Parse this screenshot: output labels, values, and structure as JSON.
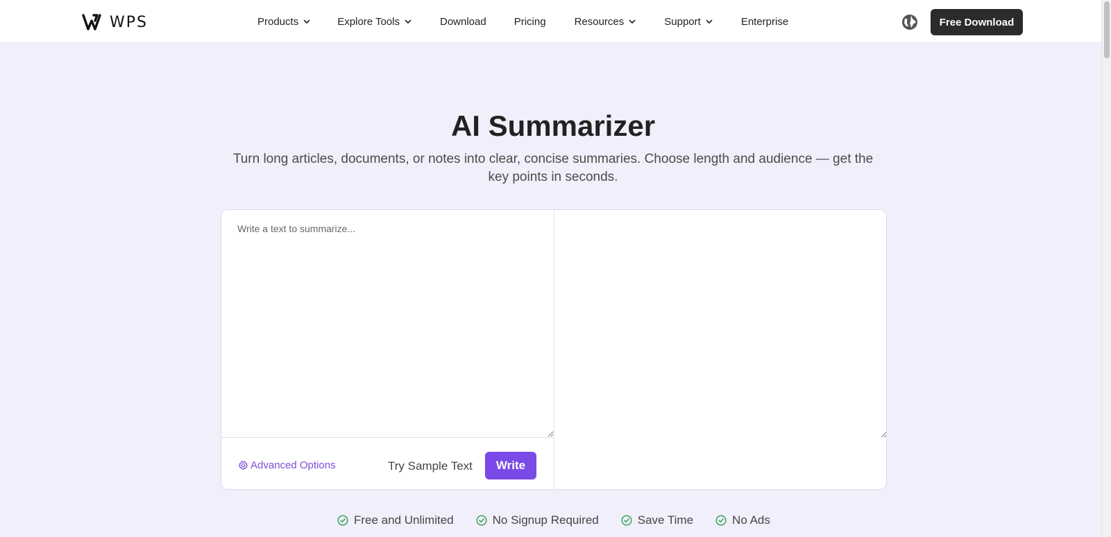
{
  "header": {
    "logo_text": "WPS",
    "nav": [
      {
        "label": "Products",
        "has_dropdown": true
      },
      {
        "label": "Explore Tools",
        "has_dropdown": true
      },
      {
        "label": "Download",
        "has_dropdown": false
      },
      {
        "label": "Pricing",
        "has_dropdown": false
      },
      {
        "label": "Resources",
        "has_dropdown": true
      },
      {
        "label": "Support",
        "has_dropdown": true
      },
      {
        "label": "Enterprise",
        "has_dropdown": false
      }
    ],
    "globe_icon": "globe-icon",
    "cta_label": "Free Download"
  },
  "hero": {
    "title": "AI Summarizer",
    "subtitle": "Turn long articles, documents, or notes into clear, concise summaries. Choose length and audience — get the key points in seconds."
  },
  "editor": {
    "input_placeholder": "Write a text to summarize...",
    "input_value": "",
    "output_value": "",
    "advanced_label": "Advanced Options",
    "advanced_icon": "gear-icon",
    "sample_label": "Try Sample Text",
    "write_label": "Write"
  },
  "features": [
    {
      "label": "Free and Unlimited",
      "icon": "check-circle-icon"
    },
    {
      "label": "No Signup Required",
      "icon": "check-circle-icon"
    },
    {
      "label": "Save Time",
      "icon": "check-circle-icon"
    },
    {
      "label": "No Ads",
      "icon": "check-circle-icon"
    }
  ],
  "colors": {
    "accent": "#7a4ae6",
    "link": "#7c4ddb",
    "background": "#f2effc",
    "cta_dark": "#2b2b2b",
    "check_green": "#3aa356"
  }
}
